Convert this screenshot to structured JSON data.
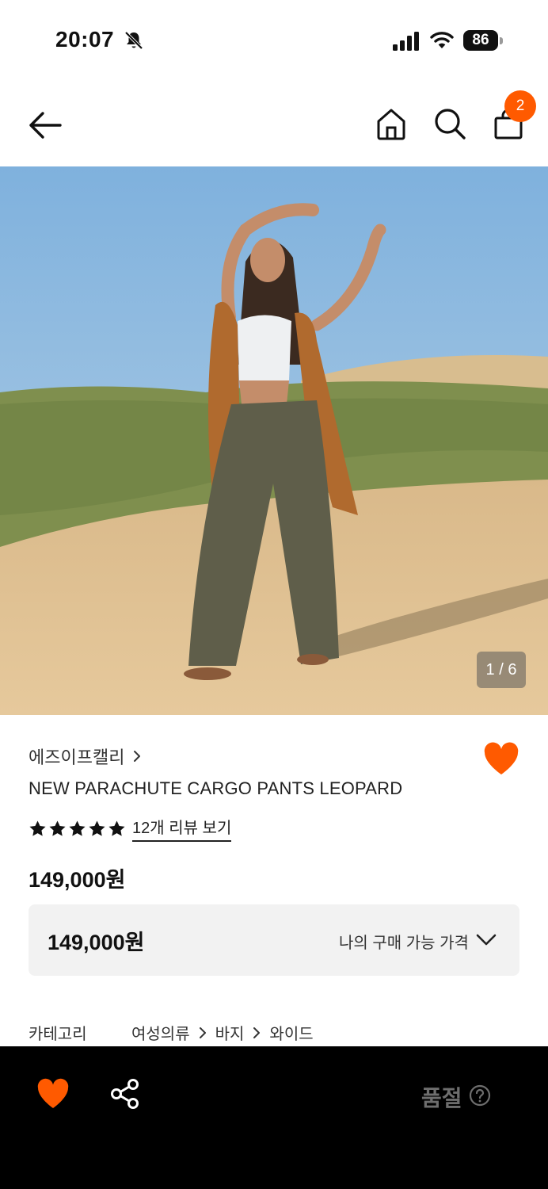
{
  "status_bar": {
    "time": "20:07",
    "battery": "86"
  },
  "header": {
    "cart_count": "2"
  },
  "hero": {
    "image_counter": "1 / 6"
  },
  "product": {
    "brand": "에즈이프캘리",
    "name": "NEW PARACHUTE CARGO PANTS LEOPARD",
    "rating_stars": 5,
    "review_link": "12개 리뷰 보기",
    "price": "149,000원"
  },
  "price_box": {
    "amount": "149,000원",
    "label": "나의 구매 가능 가격"
  },
  "category": {
    "label": "카테고리",
    "crumbs": [
      "여성의류",
      "바지",
      "와이드"
    ]
  },
  "bottom_bar": {
    "soldout_label": "품절"
  },
  "colors": {
    "accent": "#ff5a00",
    "bottom_bar_bg": "#000000"
  },
  "icons": [
    "bell-muted-icon",
    "signal-icon",
    "wifi-icon",
    "battery-icon",
    "back-arrow-icon",
    "home-icon",
    "search-icon",
    "bag-icon",
    "heart-icon",
    "star-icon",
    "chevron-right-icon",
    "chevron-down-icon",
    "share-icon",
    "help-circle-icon"
  ]
}
